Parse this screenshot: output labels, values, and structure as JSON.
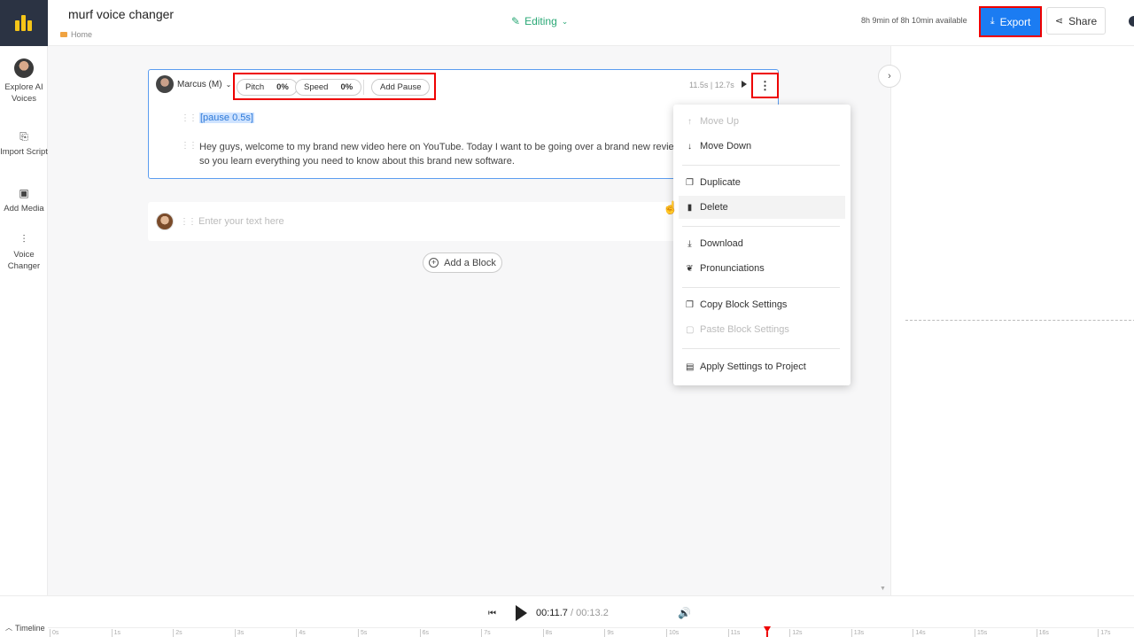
{
  "header": {
    "project_title": "murf voice changer",
    "breadcrumb": "Home",
    "mode": "Editing",
    "availability": "8h 9min of 8h 10min available",
    "export_label": "Export",
    "share_label": "Share"
  },
  "sidebar": {
    "items": [
      {
        "label": "Explore AI Voices",
        "icon": "voice-avatar-icon"
      },
      {
        "label": "Import Script",
        "icon": "import-script-icon"
      },
      {
        "label": "Add Media",
        "icon": "add-media-icon"
      },
      {
        "label": "Voice Changer",
        "icon": "voice-changer-icon"
      }
    ]
  },
  "block": {
    "voice": "Marcus (M)",
    "pitch_label": "Pitch",
    "pitch_value": "0%",
    "speed_label": "Speed",
    "speed_value": "0%",
    "add_pause_label": "Add Pause",
    "duration": "11.5s | 12.7s",
    "pause_tag": "[pause 0.5s]",
    "text": "Hey guys, welcome to my brand new video here on YouTube. Today I want to be going over a brand new review, so you learn everything you need to know about this brand new software."
  },
  "new_block": {
    "placeholder": "Enter your text here"
  },
  "add_block_label": "Add a Block",
  "menu": {
    "items": [
      {
        "label": "Move Up",
        "icon": "arrow-up-icon",
        "disabled": true
      },
      {
        "label": "Move Down",
        "icon": "arrow-down-icon",
        "disabled": false
      },
      {
        "label": "Duplicate",
        "icon": "duplicate-icon",
        "disabled": false
      },
      {
        "label": "Delete",
        "icon": "trash-icon",
        "disabled": false,
        "hovered": true
      },
      {
        "label": "Download",
        "icon": "download-icon",
        "disabled": false
      },
      {
        "label": "Pronunciations",
        "icon": "pronunciation-icon",
        "disabled": false
      },
      {
        "label": "Copy Block Settings",
        "icon": "copy-icon",
        "disabled": false
      },
      {
        "label": "Paste Block Settings",
        "icon": "paste-icon",
        "disabled": true
      },
      {
        "label": "Apply Settings to Project",
        "icon": "apply-settings-icon",
        "disabled": false
      }
    ]
  },
  "player": {
    "timeline_label": "Timeline",
    "current_time": "00:11.7",
    "total_time": "/ 00:13.2",
    "ruler_ticks": [
      "0s",
      "1s",
      "2s",
      "3s",
      "4s",
      "5s",
      "6s",
      "7s",
      "8s",
      "9s",
      "10s",
      "11s",
      "12s",
      "13s",
      "14s",
      "15s",
      "16s",
      "17s"
    ]
  },
  "colors": {
    "accent": "#1b7cf2",
    "editing_green": "#2aa876",
    "highlight_red": "#e00000",
    "logo_bg": "#2b3343",
    "logo_yellow": "#f5c518"
  }
}
